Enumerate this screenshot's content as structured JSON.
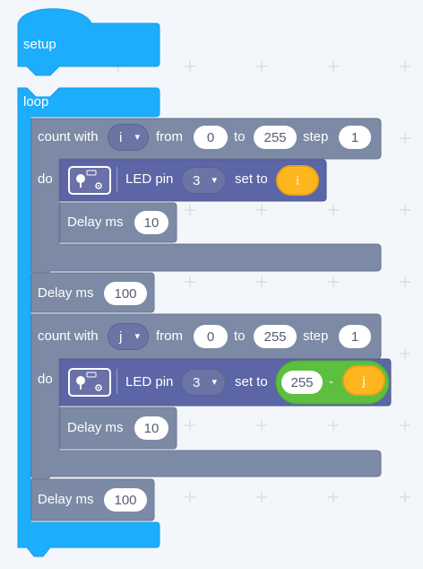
{
  "blocks": {
    "setup": {
      "label": "setup"
    },
    "loop": {
      "label": "loop"
    },
    "count_with_1": {
      "label": "count with",
      "var": "i",
      "from_label": "from",
      "from": "0",
      "to_label": "to",
      "to": "255",
      "step_label": "step",
      "step": "1",
      "do_label": "do"
    },
    "led_1": {
      "label": "LED pin",
      "pin": "3",
      "set_to_label": "set to",
      "value_var": "i"
    },
    "delay_inner_1": {
      "label": "Delay ms",
      "value": "10"
    },
    "delay_mid": {
      "label": "Delay ms",
      "value": "100"
    },
    "count_with_2": {
      "label": "count with",
      "var": "j",
      "from_label": "from",
      "from": "0",
      "to_label": "to",
      "to": "255",
      "step_label": "step",
      "step": "1",
      "do_label": "do"
    },
    "led_2": {
      "label": "LED pin",
      "pin": "3",
      "set_to_label": "set to",
      "minuend": "255",
      "operator": "-",
      "value_var": "j"
    },
    "delay_inner_2": {
      "label": "Delay ms",
      "value": "10"
    },
    "delay_end": {
      "label": "Delay ms",
      "value": "100"
    }
  },
  "colors": {
    "event_blue": "#1caefc",
    "control_gray": "#7c8aa5",
    "led_purple": "#5c65a6",
    "variable_orange": "#ffb61e",
    "math_green": "#5cbf3d",
    "workspace": "#f3f6fa"
  },
  "icons": {
    "dropdown": "▾",
    "led_module": "led-module-icon"
  }
}
